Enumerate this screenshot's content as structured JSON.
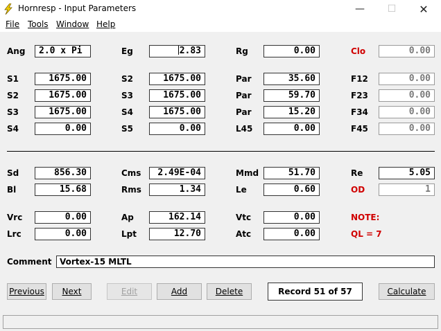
{
  "window": {
    "title": "Hornresp - Input Parameters",
    "minimize_glyph": "—",
    "maximize_glyph": "☐",
    "close_glyph": "✕",
    "icon": "lightning-bolt-icon"
  },
  "menu": {
    "file": {
      "label": "File"
    },
    "tools": {
      "label": "Tools"
    },
    "window": {
      "label": "Window"
    },
    "help": {
      "label": "Help"
    }
  },
  "params": {
    "ang": {
      "label": "Ang",
      "value": "2.0 x Pi"
    },
    "eg": {
      "label": "Eg",
      "value": "2.83"
    },
    "rg": {
      "label": "Rg",
      "value": "0.00"
    },
    "clo": {
      "label": "Clo",
      "value": "0.00"
    },
    "s1": {
      "label": "S1",
      "value": "1675.00"
    },
    "s2a": {
      "label": "S2",
      "value": "1675.00"
    },
    "par1": {
      "label": "Par",
      "value": "35.60"
    },
    "f12": {
      "label": "F12",
      "value": "0.00"
    },
    "s2": {
      "label": "S2",
      "value": "1675.00"
    },
    "s3a": {
      "label": "S3",
      "value": "1675.00"
    },
    "par2": {
      "label": "Par",
      "value": "59.70"
    },
    "f23": {
      "label": "F23",
      "value": "0.00"
    },
    "s3": {
      "label": "S3",
      "value": "1675.00"
    },
    "s4a": {
      "label": "S4",
      "value": "1675.00"
    },
    "par3": {
      "label": "Par",
      "value": "15.20"
    },
    "f34": {
      "label": "F34",
      "value": "0.00"
    },
    "s4": {
      "label": "S4",
      "value": "0.00"
    },
    "s5": {
      "label": "S5",
      "value": "0.00"
    },
    "l45": {
      "label": "L45",
      "value": "0.00"
    },
    "f45": {
      "label": "F45",
      "value": "0.00"
    },
    "sd": {
      "label": "Sd",
      "value": "856.30"
    },
    "cms": {
      "label": "Cms",
      "value": "2.49E-04"
    },
    "mmd": {
      "label": "Mmd",
      "value": "51.70"
    },
    "re": {
      "label": "Re",
      "value": "5.05"
    },
    "bl": {
      "label": "Bl",
      "value": "15.68"
    },
    "rms": {
      "label": "Rms",
      "value": "1.34"
    },
    "le": {
      "label": "Le",
      "value": "0.60"
    },
    "od": {
      "label": "OD",
      "value": "1"
    },
    "vrc": {
      "label": "Vrc",
      "value": "0.00"
    },
    "ap": {
      "label": "Ap",
      "value": "162.14"
    },
    "vtc": {
      "label": "Vtc",
      "value": "0.00"
    },
    "lrc": {
      "label": "Lrc",
      "value": "0.00"
    },
    "lpt": {
      "label": "Lpt",
      "value": "12.70"
    },
    "atc": {
      "label": "Atc",
      "value": "0.00"
    }
  },
  "notes": {
    "note": "NOTE:",
    "ql": "QL = 7"
  },
  "comment": {
    "label": "Comment",
    "value": "Vortex-15 MLTL"
  },
  "buttons": {
    "previous": "Previous",
    "next": "Next",
    "edit": "Edit",
    "add": "Add",
    "delete": "Delete",
    "calculate": "Calculate"
  },
  "record": "Record 51 of 57",
  "colors": {
    "label_red": "#d00000",
    "icon_yellow": "#f5d000"
  }
}
